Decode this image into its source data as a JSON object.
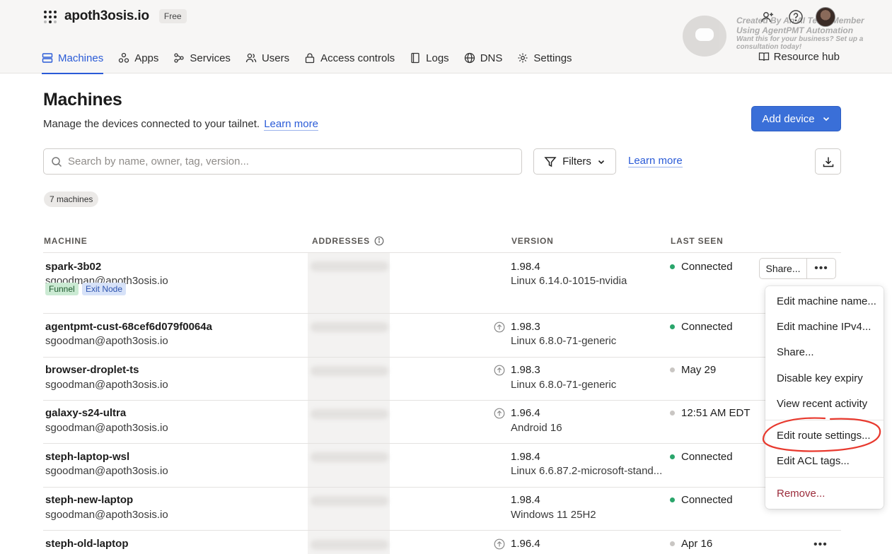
{
  "app": {
    "name": "apoth3osis.io",
    "plan": "Free"
  },
  "watermark": {
    "line1": "Created By An AI Team Member",
    "line2": "Using AgentPMT Automation",
    "line3": "Want this for your business? Set up a",
    "line4": "consultation today!"
  },
  "nav": {
    "items": [
      {
        "label": "Machines",
        "icon": "machines-icon"
      },
      {
        "label": "Apps",
        "icon": "apps-icon"
      },
      {
        "label": "Services",
        "icon": "services-icon"
      },
      {
        "label": "Users",
        "icon": "users-icon"
      },
      {
        "label": "Access controls",
        "icon": "lock-icon"
      },
      {
        "label": "Logs",
        "icon": "logs-icon"
      },
      {
        "label": "DNS",
        "icon": "globe-icon"
      },
      {
        "label": "Settings",
        "icon": "gear-icon"
      }
    ],
    "active": "Machines",
    "resource_hub": "Resource hub"
  },
  "page": {
    "title": "Machines",
    "subtitle": "Manage the devices connected to your tailnet.",
    "learn_more": "Learn more",
    "add_device": "Add device",
    "search_placeholder": "Search by name, owner, tag, version...",
    "filters": "Filters",
    "learn_more_2": "Learn more",
    "machine_count": "7 machines"
  },
  "table": {
    "headers": {
      "machine": "MACHINE",
      "addresses": "ADDRESSES",
      "version": "VERSION",
      "last_seen": "LAST SEEN"
    },
    "rows": [
      {
        "name": "spark-3b02",
        "owner": "sgoodman@apoth3osis.io",
        "version": "1.98.4",
        "os": "Linux 6.14.0-1015-nvidia",
        "last_seen": "Connected",
        "online": true,
        "update": false,
        "tags": [
          "Funnel",
          "Exit Node"
        ]
      },
      {
        "name": "agentpmt-cust-68cef6d079f0064a",
        "owner": "sgoodman@apoth3osis.io",
        "version": "1.98.3",
        "os": "Linux 6.8.0-71-generic",
        "last_seen": "Connected",
        "online": true,
        "update": true
      },
      {
        "name": "browser-droplet-ts",
        "owner": "sgoodman@apoth3osis.io",
        "version": "1.98.3",
        "os": "Linux 6.8.0-71-generic",
        "last_seen": "May 29",
        "online": false,
        "update": true
      },
      {
        "name": "galaxy-s24-ultra",
        "owner": "sgoodman@apoth3osis.io",
        "version": "1.96.4",
        "os": "Android 16",
        "last_seen": "12:51 AM EDT",
        "online": false,
        "update": true
      },
      {
        "name": "steph-laptop-wsl",
        "owner": "sgoodman@apoth3osis.io",
        "version": "1.98.4",
        "os": "Linux 6.6.87.2-microsoft-stand...",
        "last_seen": "Connected",
        "online": true,
        "update": false
      },
      {
        "name": "steph-new-laptop",
        "owner": "sgoodman@apoth3osis.io",
        "version": "1.98.4",
        "os": "Windows 11 25H2",
        "last_seen": "Connected",
        "online": true,
        "update": false
      },
      {
        "name": "steph-old-laptop",
        "owner": "",
        "version": "1.96.4",
        "os": "",
        "last_seen": "Apr 16",
        "online": false,
        "update": true
      }
    ],
    "share_label": "Share...",
    "more_label": "•••"
  },
  "menu": {
    "items": [
      "Edit machine name...",
      "Edit machine IPv4...",
      "Share...",
      "Disable key expiry",
      "View recent activity",
      "Edit route settings...",
      "Edit ACL tags...",
      "Remove..."
    ]
  },
  "colors": {
    "accent": "#2a5bd7",
    "button": "#3a6fd8",
    "online": "#2aa56b",
    "danger": "#9b2b3a",
    "annotation": "#e8392e"
  }
}
